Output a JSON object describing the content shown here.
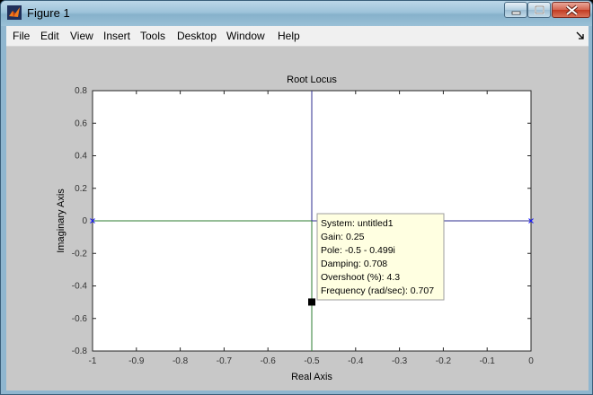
{
  "window": {
    "title": "Figure 1",
    "controls": [
      "minimize",
      "maximize",
      "close"
    ],
    "app_icon": "matlab-icon"
  },
  "menu": {
    "items": [
      "File",
      "Edit",
      "View",
      "Insert",
      "Tools",
      "Desktop",
      "Window",
      "Help"
    ],
    "dock_icon": "dock-arrow-icon"
  },
  "colors": {
    "plot_background": "#ffffff",
    "figure_background": "#c8c8c8",
    "locus_line": "#2d2d8f",
    "grid_line": "#2e7d32",
    "pole_marker": "#1a1aff",
    "datatip_background": "#ffffe1",
    "datatip_marker": "#000000"
  },
  "chart_data": {
    "type": "line",
    "title": "Root Locus",
    "xlabel": "Real Axis",
    "ylabel": "Imaginary Axis",
    "xlim": [
      -1,
      0
    ],
    "ylim": [
      -0.8,
      0.8
    ],
    "xticks": [
      "-1",
      "-0.9",
      "-0.8",
      "-0.7",
      "-0.6",
      "-0.5",
      "-0.4",
      "-0.3",
      "-0.2",
      "-0.1",
      "0"
    ],
    "yticks": [
      "0.8",
      "0.6",
      "0.4",
      "0.2",
      "0",
      "-0.2",
      "-0.4",
      "-0.6",
      "-0.8"
    ],
    "grid": false,
    "open_loop_poles": [
      {
        "x": -1,
        "y": 0
      },
      {
        "x": 0,
        "y": 0
      }
    ],
    "locus_branches": [
      {
        "x": [
          -1,
          -0.5
        ],
        "y": [
          0,
          0
        ]
      },
      {
        "x": [
          0,
          -0.5
        ],
        "y": [
          0,
          0
        ]
      },
      {
        "x": [
          -0.5,
          -0.5
        ],
        "y": [
          0,
          0.8
        ]
      },
      {
        "x": [
          -0.5,
          -0.5
        ],
        "y": [
          0,
          -0.8
        ]
      }
    ],
    "selected_point": {
      "x": -0.5,
      "y": -0.499
    },
    "datatip": {
      "lines": [
        "System: untitled1",
        "Gain: 0.25",
        "Pole: -0.5 - 0.499i",
        "Damping: 0.708",
        "Overshoot (%): 4.3",
        "Frequency (rad/sec): 0.707"
      ]
    }
  }
}
